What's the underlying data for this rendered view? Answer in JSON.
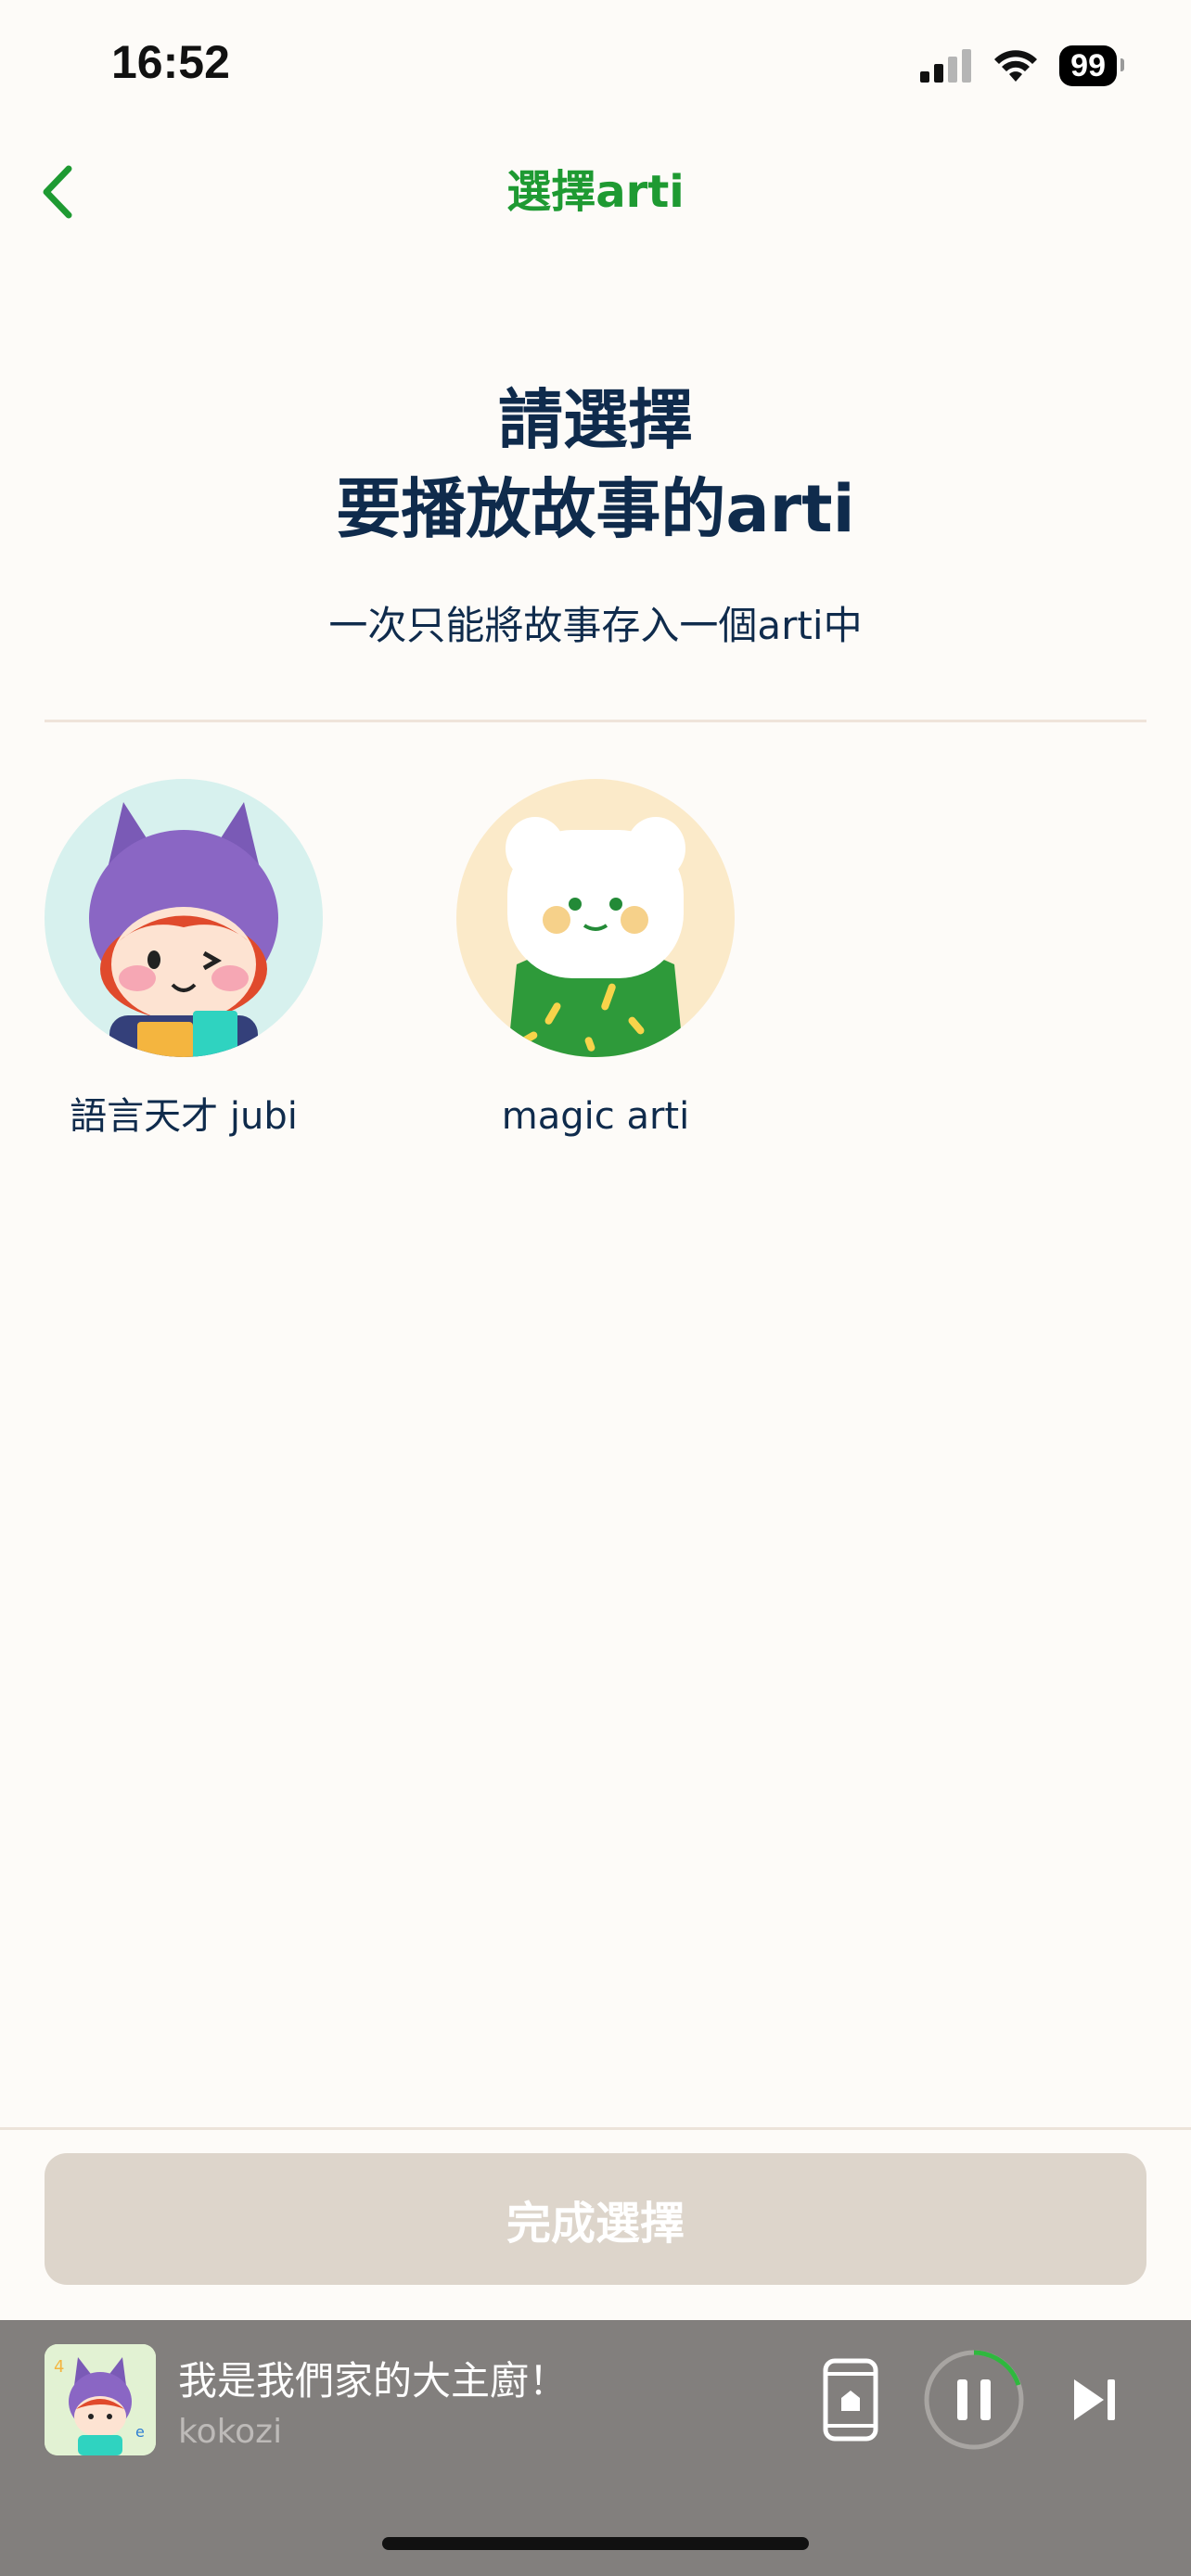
{
  "status_bar": {
    "time": "16:52",
    "battery": "99",
    "icons": [
      "signal-icon",
      "wifi-icon",
      "battery-icon"
    ]
  },
  "nav": {
    "back_icon": "chevron-left-icon",
    "title": "選擇arti"
  },
  "heading": {
    "line1": "請選擇",
    "line2": "要播放故事的arti",
    "subtitle": "一次只能將故事存入一個arti中"
  },
  "artis": [
    {
      "name": "語言天才 jubi"
    },
    {
      "name": "magic arti"
    }
  ],
  "done_button": {
    "label": "完成選擇"
  },
  "player": {
    "title": "我是我們家的大主廚！",
    "artist": "kokozi",
    "device_icon": "phone-device-icon",
    "pause_icon": "pause-icon",
    "next_icon": "skip-next-icon"
  },
  "colors": {
    "accent": "#1e9a32",
    "heading": "#0f2b4c",
    "background": "#fdfbf8",
    "button_disabled": "#ddd5cb",
    "player_bg": "#827f7d"
  }
}
